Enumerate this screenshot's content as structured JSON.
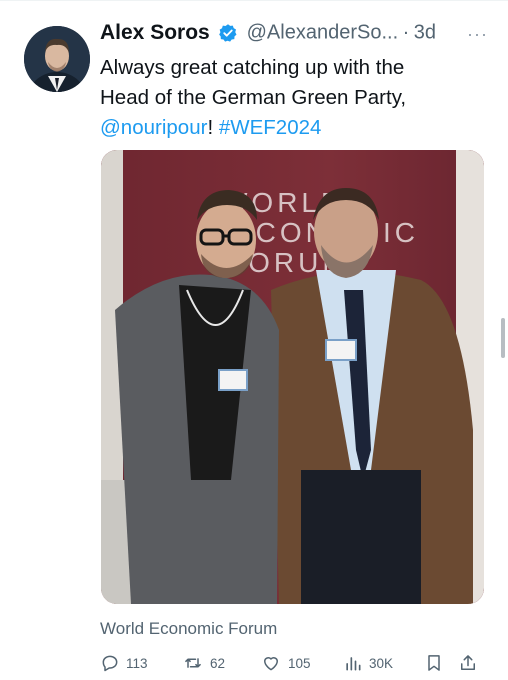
{
  "tweet": {
    "author_name": "Alex Soros",
    "handle": "@AlexanderSo...",
    "separator": "·",
    "time": "3d",
    "more_label": "···",
    "text_line1": "Always great catching up with the",
    "text_line2": "Head of the German Green Party,",
    "mention": "@nouripour",
    "exclamation": "!",
    "hashtag": "#WEF2024",
    "photo_sign_text": "WORLD ECONOMIC FORUM",
    "source_label": "World Economic Forum"
  },
  "actions": {
    "replies": "113",
    "retweets": "62",
    "likes": "105",
    "views": "30K"
  },
  "colors": {
    "link": "#1d9bf0",
    "verified": "#1d9bf0",
    "muted": "#536471",
    "photo_backdrop": "#7a2b34"
  }
}
